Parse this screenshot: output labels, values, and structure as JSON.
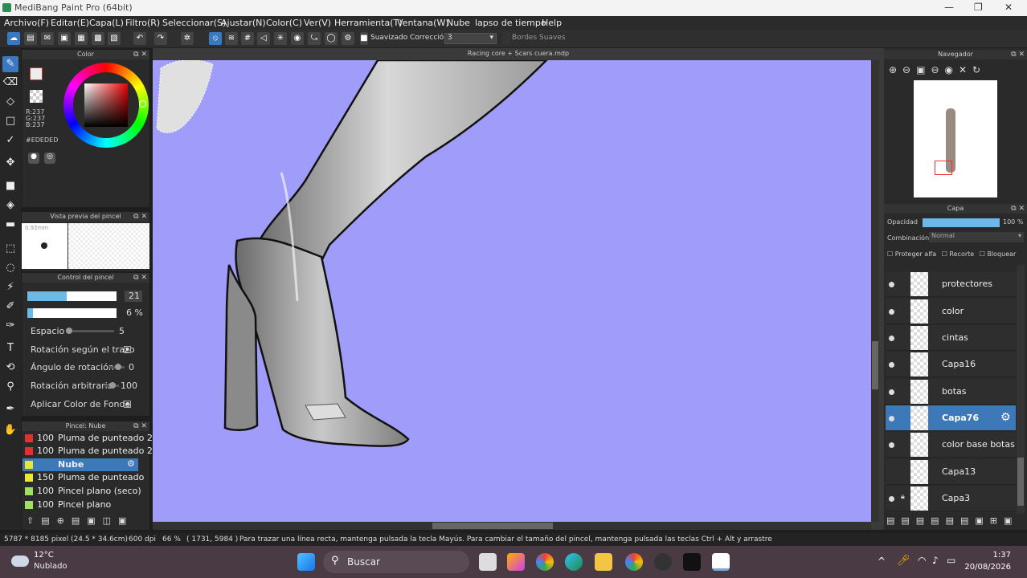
{
  "window": {
    "title": "MediBang Paint Pro (64bit)"
  },
  "menu": [
    "Archivo(F)",
    "Editar(E)",
    "Capa(L)",
    "Filtro(R)",
    "Seleccionar(S)",
    "Ajustar(N)",
    "Color(C)",
    "Ver(V)",
    "Herramienta(T)",
    "Ventana(W)",
    "Nube",
    "lapso de tiempo",
    "Help"
  ],
  "toolbar": {
    "suavizado": "Suavizado",
    "correccion": "Corrección",
    "correccion_val": "3",
    "bordes": "Bordes Suaves"
  },
  "color_panel": {
    "title": "Color",
    "r": "R:237",
    "g": "G:237",
    "b": "B:237",
    "hex": "#EDEDED"
  },
  "brush_preview": {
    "title": "Vista previa del pincel",
    "size": "0.92mm"
  },
  "brush_control": {
    "title": "Control del pincel",
    "size_val": "21",
    "opacity_val": "6 %",
    "espacio": "Espacio",
    "espacio_val": "5",
    "rot_trazo": "Rotación según el trazo",
    "angulo": "Ángulo de rotación",
    "angulo_val": "0",
    "rot_arb": "Rotación arbitraria",
    "rot_arb_val": "100",
    "aplicar": "Aplicar Color de Fondo"
  },
  "brush_list": {
    "title": "Pincel: Nube",
    "items": [
      {
        "n": "100",
        "l": "Pluma de punteado 2",
        "c": "#e03030"
      },
      {
        "n": "100",
        "l": "Pluma de punteado 2",
        "c": "#e03030"
      },
      {
        "n": "",
        "l": "Nube",
        "c": "#e8e830"
      },
      {
        "n": "150",
        "l": "Pluma de punteado",
        "c": "#e8e830"
      },
      {
        "n": "100",
        "l": "Pincel plano (seco)",
        "c": "#a0e060"
      },
      {
        "n": "100",
        "l": "Pincel plano",
        "c": "#a0e060"
      }
    ]
  },
  "canvas": {
    "title": "Racing core + Scars cuera.mdp"
  },
  "navigator": {
    "title": "Navegador"
  },
  "layers_panel": {
    "title": "Capa",
    "opacidad": "Opacidad",
    "opacidad_val": "100 %",
    "combinacion": "Combinación",
    "combinacion_val": "Normal",
    "proteger": "Proteger alfa",
    "recorte": "Recorte",
    "bloquear": "Bloquear",
    "layers": [
      "protectores",
      "color",
      "cintas",
      "Capa16",
      "botas",
      "Capa76",
      "color base botas",
      "Capa13",
      "Capa3"
    ],
    "selected": "Capa76"
  },
  "status": {
    "size": "5787 * 8185 pixel",
    "cm": "(24.5 * 34.6cm)",
    "dpi": "600 dpi",
    "zoom": "66 %",
    "coord": "( 1731, 5984 )",
    "hint": "Para trazar una línea recta, mantenga pulsada la tecla Mayús. Para cambiar el tamaño del pincel, mantenga pulsada las teclas Ctrl + Alt y arrastre"
  },
  "taskbar": {
    "temp": "12°C",
    "weather": "Nublado",
    "search": "Buscar",
    "time": "1:37",
    "date": "20/08/2026"
  }
}
